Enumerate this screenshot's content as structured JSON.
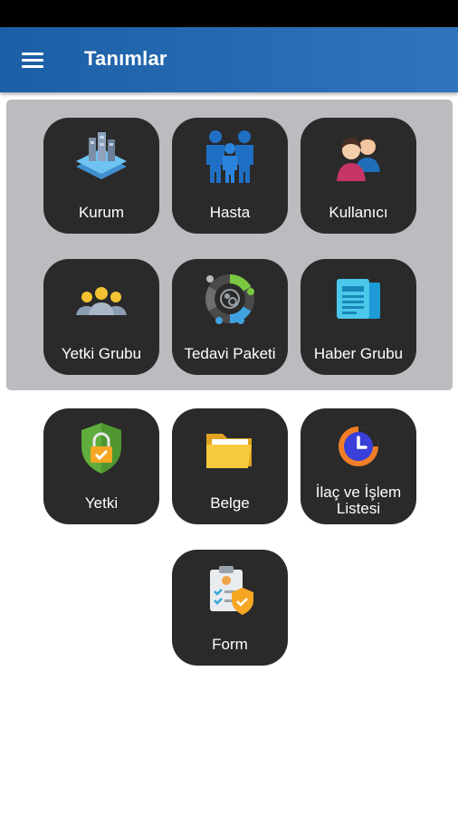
{
  "app_bar": {
    "title": "Tanımlar",
    "menu_icon": "hamburger-menu-icon"
  },
  "colors": {
    "app_bar": "#2468b0",
    "tile": "#2b2a2a",
    "group_panel": "#babcbf"
  },
  "tiles": [
    {
      "label": "Kurum",
      "icon": "building-icon"
    },
    {
      "label": "Hasta",
      "icon": "patients-icon"
    },
    {
      "label": "Kullanıcı",
      "icon": "users-icon"
    },
    {
      "label": "Yetki Grubu",
      "icon": "user-group-icon"
    },
    {
      "label": "Tedavi Paketi",
      "icon": "treatment-package-icon"
    },
    {
      "label": "Haber Grubu",
      "icon": "newspaper-icon"
    },
    {
      "label": "Yetki",
      "icon": "shield-lock-icon"
    },
    {
      "label_line1": "İlaç ve İşlem",
      "label_line2": "Listesi",
      "icon": "clock-icon"
    },
    {
      "label": "Belge",
      "icon": "folder-icon"
    },
    {
      "label": "Form",
      "icon": "clipboard-shield-icon"
    }
  ]
}
